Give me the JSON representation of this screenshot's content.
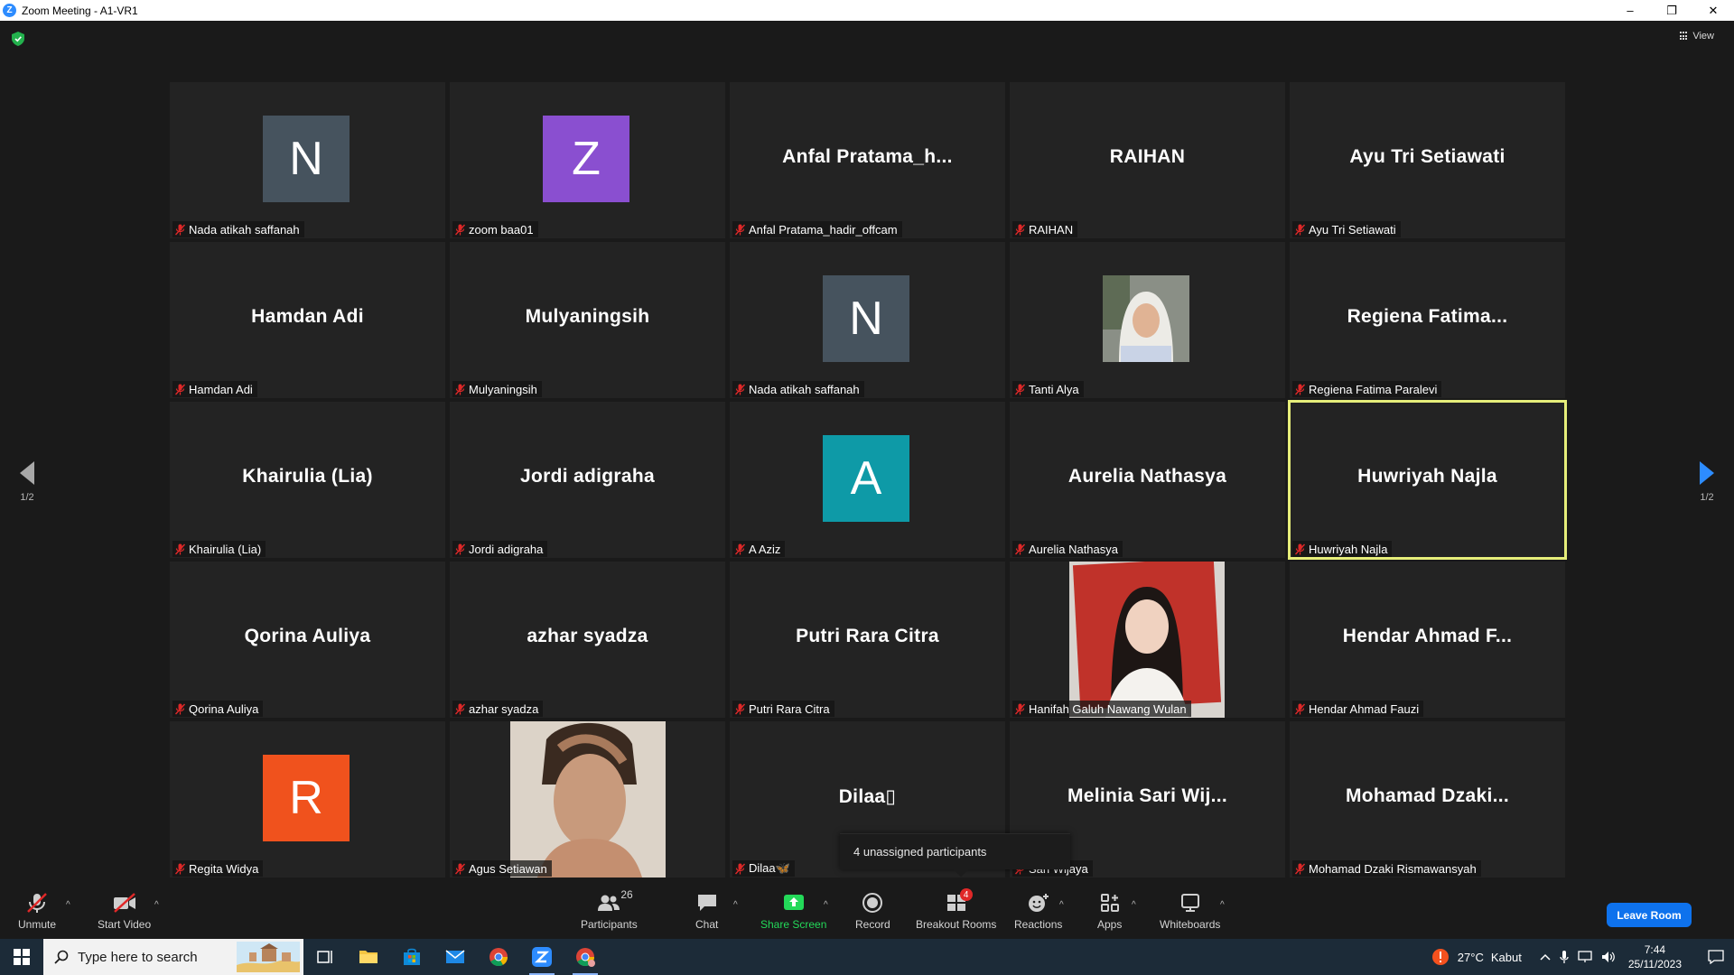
{
  "window": {
    "title": "Zoom Meeting - A1-VR1",
    "logo_letter": "Z",
    "minimize": "–",
    "restore": "❐",
    "close": "✕"
  },
  "meeting": {
    "view_label": "View",
    "page_indicator_left": "1/2",
    "page_indicator_right": "1/2",
    "tooltip": "4 unassigned participants",
    "tiles": [
      {
        "big": "",
        "avatar": "N",
        "avatar_color": "#46535e",
        "label": "Nada atikah saffanah"
      },
      {
        "big": "",
        "avatar": "Z",
        "avatar_color": "#8a4fd0",
        "label": "zoom baa01"
      },
      {
        "big": "Anfal  Pratama_h...",
        "label": "Anfal Pratama_hadir_offcam"
      },
      {
        "big": "RAIHAN",
        "label": "RAIHAN"
      },
      {
        "big": "Ayu Tri Setiawati",
        "label": "Ayu Tri Setiawati"
      },
      {
        "big": "Hamdan Adi",
        "label": "Hamdan Adi"
      },
      {
        "big": "Mulyaningsih",
        "label": "Mulyaningsih"
      },
      {
        "big": "",
        "avatar": "N",
        "avatar_color": "#46535e",
        "label": "Nada atikah saffanah"
      },
      {
        "big": "",
        "photo": "hijab",
        "label": "Tanti Alya"
      },
      {
        "big": "Regiena  Fatima...",
        "label": "Regiena Fatima Paralevi"
      },
      {
        "big": "Khairulia (Lia)",
        "label": "Khairulia (Lia)"
      },
      {
        "big": "Jordi adigraha",
        "label": "Jordi adigraha"
      },
      {
        "big": "",
        "avatar": "A",
        "avatar_color": "#0e9aa7",
        "label": "A Aziz"
      },
      {
        "big": "Aurelia Nathasya",
        "label": "Aurelia Nathasya"
      },
      {
        "big": "Huwriyah Najla",
        "label": "Huwriyah Najla",
        "active": true
      },
      {
        "big": "Qorina Auliya",
        "label": "Qorina Auliya"
      },
      {
        "big": "azhar syadza",
        "label": "azhar syadza"
      },
      {
        "big": "Putri Rara Citra",
        "label": "Putri Rara Citra"
      },
      {
        "big": "",
        "photo": "redbg",
        "label": "Hanifah Galuh Nawang Wulan"
      },
      {
        "big": "Hendar Ahmad  F...",
        "label": "Hendar Ahmad Fauzi"
      },
      {
        "big": "",
        "avatar": "R",
        "avatar_color": "#f0521d",
        "label": "Regita Widya"
      },
      {
        "big": "",
        "photo": "boy",
        "label": "Agus Setiawan"
      },
      {
        "big": "Dilaa▯",
        "label": "Dilaa🦋"
      },
      {
        "big": "Melinia Sari Wij...",
        "label": "Sari Wijaya"
      },
      {
        "big": "Mohamad  Dzaki...",
        "label": "Mohamad Dzaki Rismawansyah"
      }
    ]
  },
  "toolbar": {
    "unmute": "Unmute",
    "start_video": "Start Video",
    "participants": "Participants",
    "participants_count": "26",
    "chat": "Chat",
    "share_screen": "Share Screen",
    "record": "Record",
    "breakout_rooms": "Breakout Rooms",
    "breakout_badge": "4",
    "reactions": "Reactions",
    "apps": "Apps",
    "whiteboards": "Whiteboards",
    "leave": "Leave Room",
    "caret": "^"
  },
  "taskbar": {
    "search_placeholder": "Type here to search",
    "weather_temp": "27°C",
    "weather_text": "Kabut",
    "time": "7:44",
    "date": "25/11/2023"
  },
  "colors": {
    "accent_blue": "#0e72ed",
    "share_green": "#23d959",
    "active_speaker": "#e6ee7a",
    "mic_off_red": "#e02828"
  }
}
